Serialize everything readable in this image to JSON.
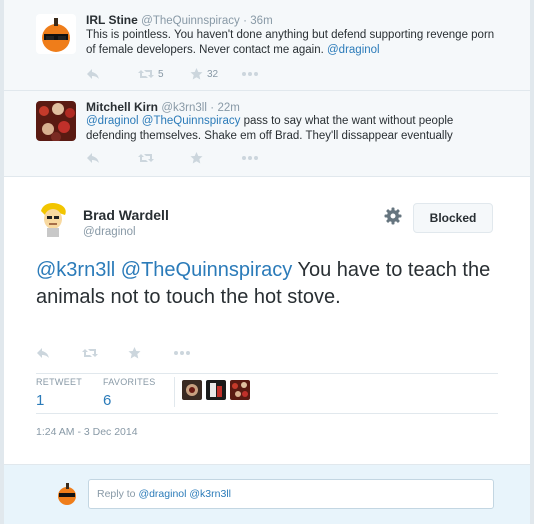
{
  "replies": [
    {
      "name": "IRL Stine",
      "handle": "@TheQuinnspiracy",
      "sep": "·",
      "time": "36m",
      "text_plain": "This is pointless. You haven't done anything but defend supporting revenge porn of female developers. Never contact me again. ",
      "text_link": "@draginol",
      "retweets": "5",
      "favorites": "32"
    },
    {
      "name": "Mitchell Kirn",
      "handle": "@k3rn3ll",
      "sep": "·",
      "time": "22m",
      "mention1": "@draginol",
      "mention2": "@TheQuinnspiracy",
      "text_plain": " pass to say what the want without people defending themselves. Shake em off Brad. They'll  dissappear eventually"
    }
  ],
  "main_tweet": {
    "name": "Brad Wardell",
    "handle": "@draginol",
    "blocked_label": "Blocked",
    "mention1": "@k3rn3ll",
    "mention2": "@TheQuinnspiracy",
    "text_plain": " You have to teach the animals not to touch the hot stove.",
    "retweet_label": "RETWEET",
    "retweet_count": "1",
    "favorites_label": "FAVORITES",
    "favorites_count": "6",
    "timestamp": "1:24 AM - 3 Dec 2014"
  },
  "reply_box": {
    "prefix": "Reply to ",
    "mention1": "@draginol",
    "mention2": "@k3rn3ll"
  },
  "colors": {
    "link": "#2b7bb9",
    "muted": "#8899a6",
    "icon": "#ccd6dd"
  },
  "icons": [
    "reply-icon",
    "retweet-icon",
    "favorite-icon",
    "more-icon",
    "gear-icon"
  ]
}
